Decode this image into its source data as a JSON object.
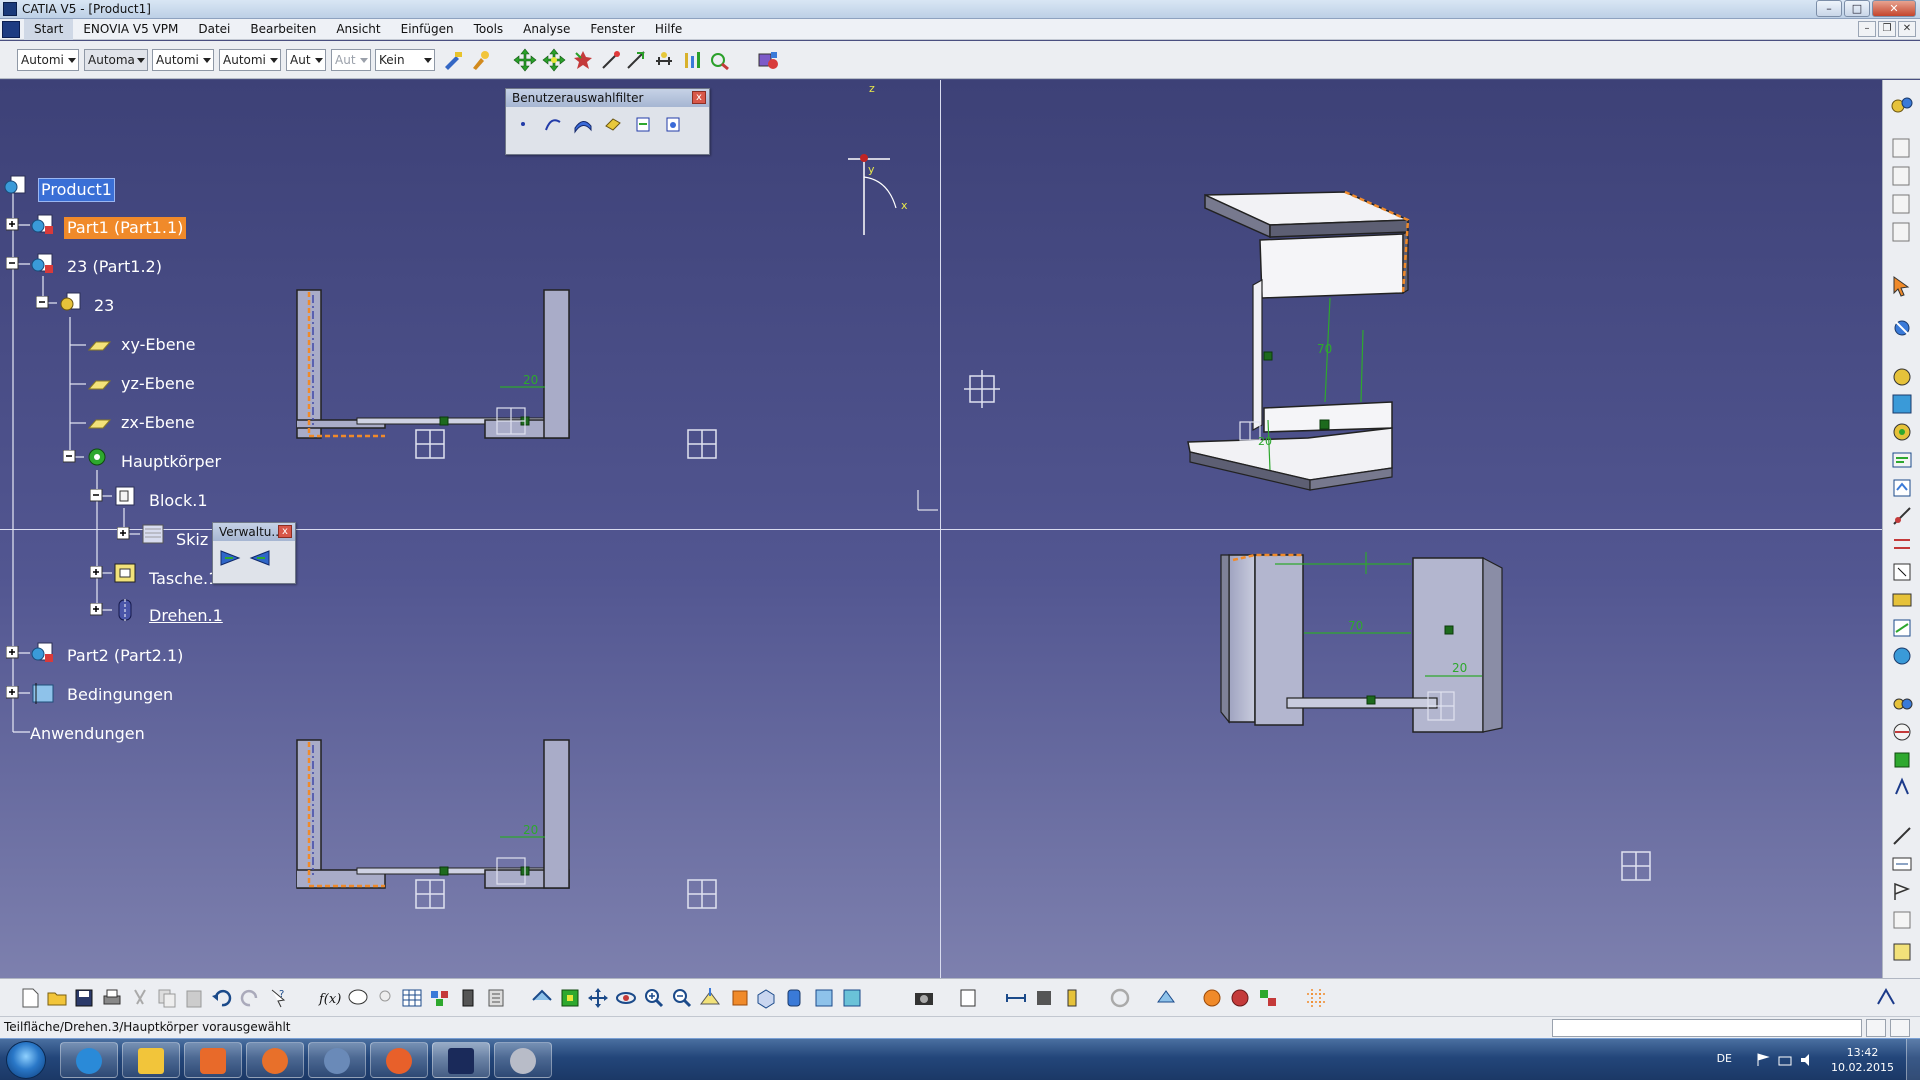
{
  "window": {
    "title": "CATIA V5 - [Product1]"
  },
  "menubar": {
    "items": [
      "Start",
      "ENOVIA V5 VPM",
      "Datei",
      "Bearbeiten",
      "Ansicht",
      "Einfügen",
      "Tools",
      "Analyse",
      "Fenster",
      "Hilfe"
    ]
  },
  "toolbar": {
    "combos": [
      "Automi",
      "Automa",
      "Automi",
      "Automi",
      "Aut",
      "Aut",
      "Kein"
    ]
  },
  "tree": {
    "product": "Product1",
    "part1": "Part1 (Part1.1)",
    "part_23": "23 (Part1.2)",
    "part_23_root": "23",
    "xy": "xy-Ebene",
    "yz": "yz-Ebene",
    "zx": "zx-Ebene",
    "body": "Hauptkörper",
    "block": "Block.1",
    "sketch": "Skiz",
    "pocket": "Tasche.1",
    "shaft": "Drehen.1",
    "part2": "Part2 (Part2.1)",
    "constraints": "Bedingungen",
    "applications": "Anwendungen"
  },
  "floating": {
    "filter_title": "Benutzerauswahlfilter",
    "manage_title": "Verwaltu...",
    "close_glyph": "x"
  },
  "viewport": {
    "axis": {
      "y": "y",
      "x": "x",
      "z": "z"
    },
    "dimensions": {
      "d20_front": "20",
      "d20_bottom": "20",
      "d70_iso": "70",
      "d20_iso": "20",
      "d70_right": "70",
      "d20_right": "20"
    }
  },
  "statusbar": {
    "text": "Teilfläche/Drehen.3/Hauptkörper vorausgewählt"
  },
  "taskbar": {
    "lang": "DE",
    "time": "13:42",
    "date": "10.02.2015"
  },
  "colors": {
    "viewport_top": "#3d4177",
    "viewport_bottom": "#7d80ae",
    "selection_orange": "#f08a2a",
    "selection_blue": "#3a6fd6",
    "dimension_green": "#2ea82e"
  }
}
